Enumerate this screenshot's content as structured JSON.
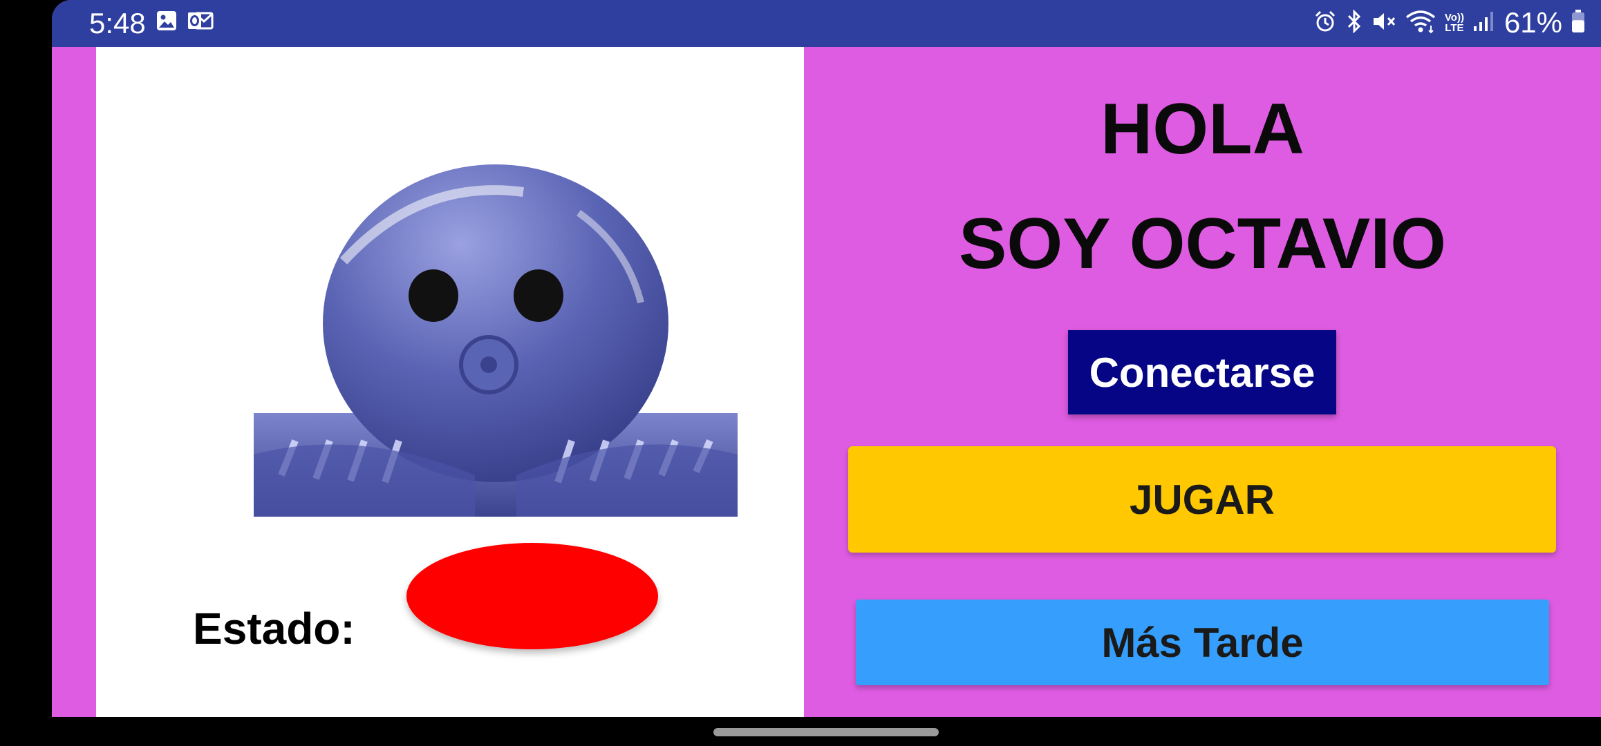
{
  "status_bar": {
    "time": "5:48",
    "battery_text": "61%",
    "battery_level": 0.61,
    "left_icons": [
      "image-icon",
      "outlook-icon"
    ],
    "right_icons": [
      "alarm-icon",
      "bluetooth-icon",
      "mute-icon",
      "wifi-icon",
      "volte-icon",
      "signal-icon",
      "battery-icon"
    ],
    "volte_label_top": "Vo))",
    "volte_label_bottom": "LTE"
  },
  "colors": {
    "background": "#de5ce2",
    "status_bar": "#2f3f9f",
    "connect_button": "#050585",
    "play_button": "#ffc800",
    "later_button": "#369ffd",
    "status_indicator": "#ff0000",
    "octopus": "#5a64b4"
  },
  "left_panel": {
    "image": "octopus-robot-icon",
    "estado_label": "Estado:"
  },
  "right_panel": {
    "greeting_line1": "HOLA",
    "greeting_line2": "SOY OCTAVIO",
    "connect_label": "Conectarse",
    "play_label": "JUGAR",
    "later_label": "Más Tarde"
  }
}
